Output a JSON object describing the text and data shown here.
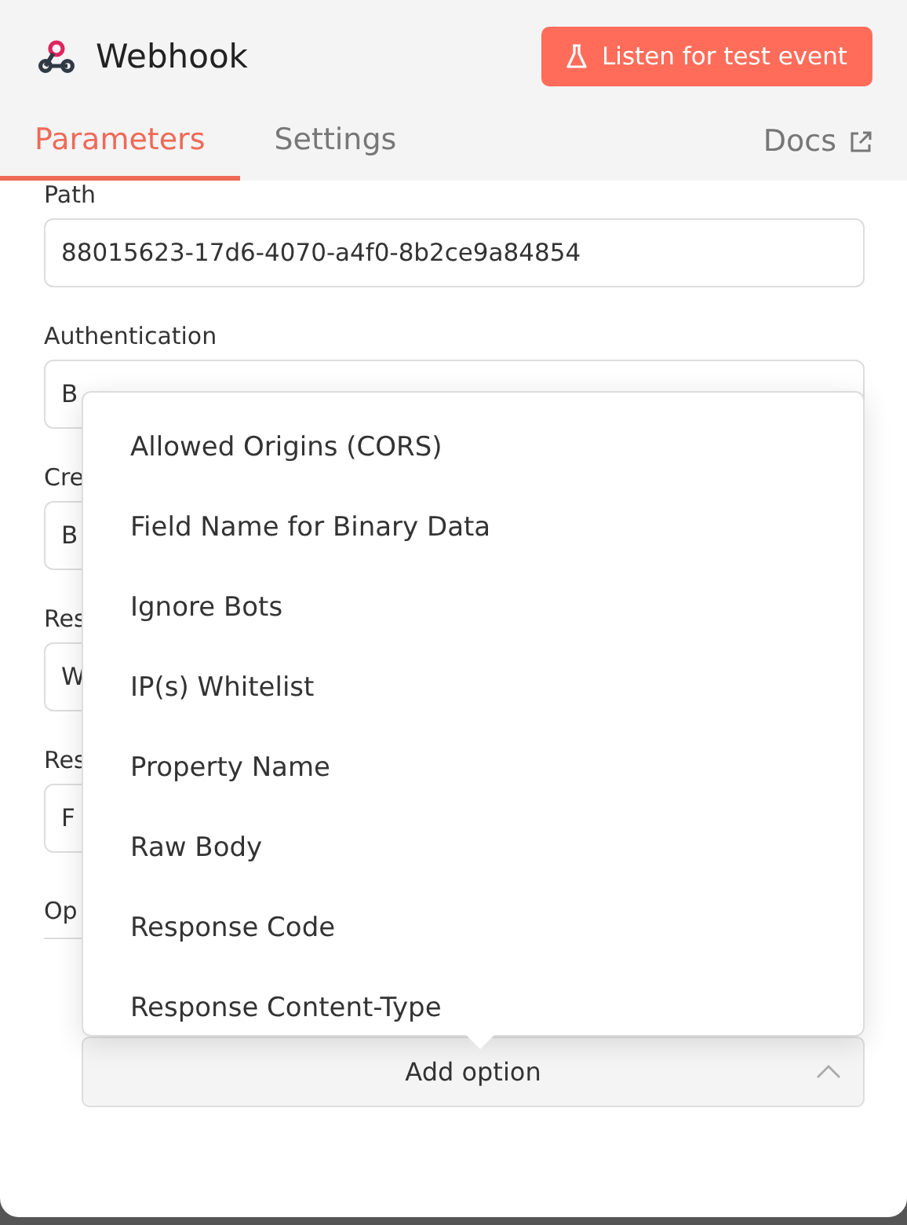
{
  "header": {
    "title": "Webhook",
    "action_button": "Listen for test event"
  },
  "tabs": [
    {
      "label": "Parameters",
      "selected": true
    },
    {
      "label": "Settings",
      "selected": false
    }
  ],
  "docs_link": "Docs",
  "fields": [
    {
      "label": "Path",
      "value": "88015623-17d6-4070-a4f0-8b2ce9a84854"
    },
    {
      "label": "Authentication",
      "value": "B"
    },
    {
      "label": "Cre",
      "value": "B"
    },
    {
      "label": "Res",
      "value": "W"
    },
    {
      "label": "Res",
      "value": "F"
    }
  ],
  "options_label": "Op",
  "dropdown": {
    "items": [
      "Allowed Origins (CORS)",
      "Field Name for Binary Data",
      "Ignore Bots",
      "IP(s) Whitelist",
      "Property Name",
      "Raw Body",
      "Response Code",
      "Response Content-Type"
    ]
  },
  "add_option": {
    "label": "Add option",
    "expanded": true
  }
}
